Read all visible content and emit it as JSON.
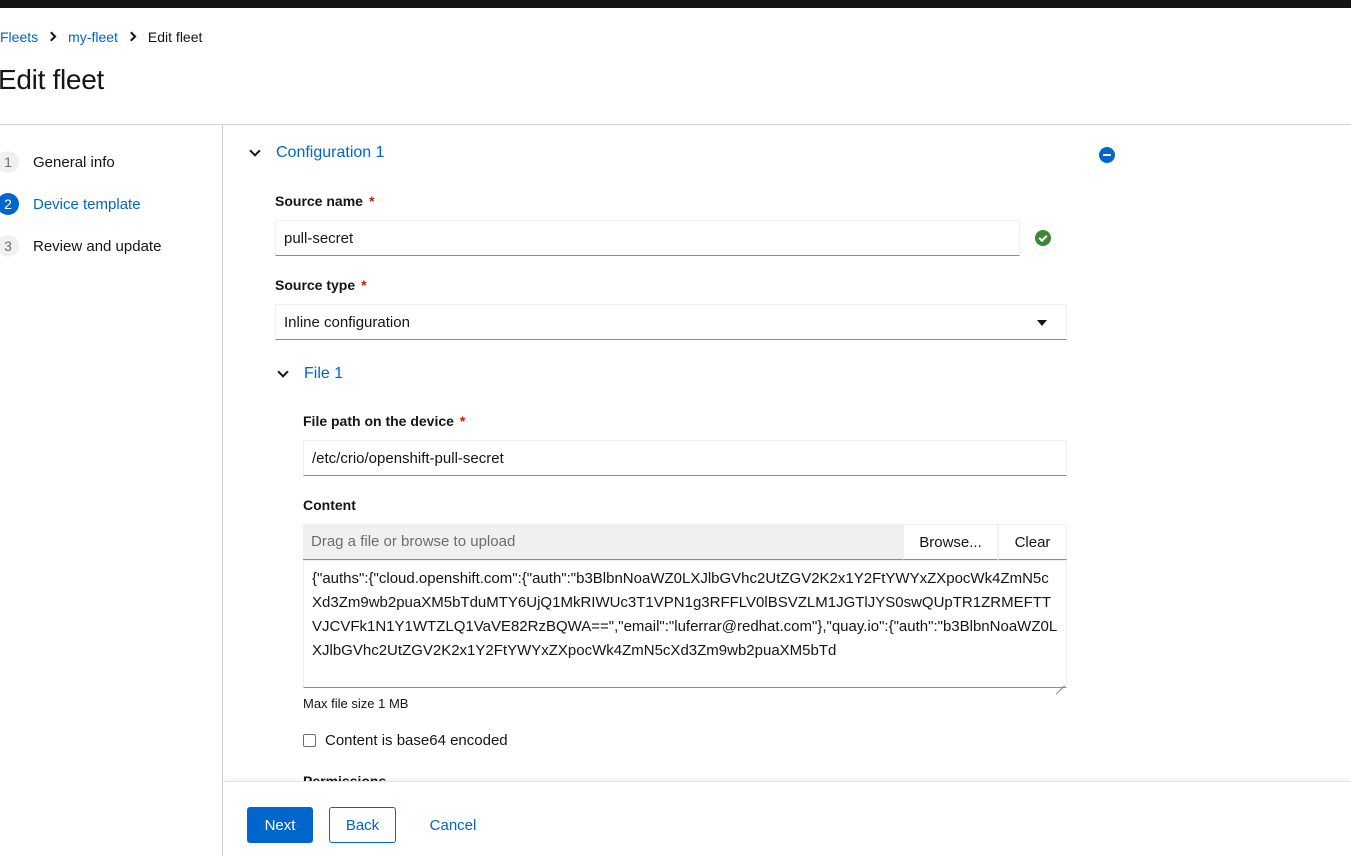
{
  "breadcrumb": {
    "items": [
      {
        "label": "Fleets"
      },
      {
        "label": "my-fleet"
      }
    ],
    "current": "Edit fleet"
  },
  "page": {
    "title": "Edit fleet"
  },
  "wizard": {
    "active_step": 2,
    "steps": [
      {
        "number": "1",
        "label": "General info"
      },
      {
        "number": "2",
        "label": "Device template"
      },
      {
        "number": "3",
        "label": "Review and update"
      }
    ]
  },
  "config": {
    "title": "Configuration 1",
    "source_name": {
      "label": "Source name",
      "required_mark": "*",
      "value": "pull-secret",
      "valid": true
    },
    "source_type": {
      "label": "Source type",
      "required_mark": "*",
      "selected": "Inline configuration"
    },
    "file": {
      "title": "File 1",
      "path": {
        "label": "File path on the device",
        "required_mark": "*",
        "value": "/etc/crio/openshift-pull-secret"
      },
      "content": {
        "label": "Content",
        "upload_placeholder": "Drag a file or browse to upload",
        "browse_label": "Browse...",
        "clear_label": "Clear",
        "value": "{\"auths\":{\"cloud.openshift.com\":{\"auth\":\"b3BlbnNoaWZ0LXJlbGVhc2UtZGV2K2x1Y2FtYWYxZXpocWk4ZmN5cXd3Zm9wb2puaXM5bTduMTY6UjQ1MkRIWUc3T1VPN1g3RFFLV0lBSVZLM1JGTlJYS0swQUpTR1ZRMEFTTVJCVFk1N1Y1WTZLQ1VaVE82RzBQWA==\",\"email\":\"luferrar@redhat.com\"},\"quay.io\":{\"auth\":\"b3BlbnNoaWZ0LXJlbGVhc2UtZGV2K2x1Y2FtYWYxZXpocWk4ZmN5cXd3Zm9wb2puaXM5bTd",
        "helper": "Max file size 1 MB"
      },
      "base64_checkbox": {
        "label": "Content is base64 encoded",
        "checked": false
      },
      "permissions_label": "Permissions"
    }
  },
  "footer": {
    "next_label": "Next",
    "back_label": "Back",
    "cancel_label": "Cancel"
  },
  "colors": {
    "primary": "#0066cc",
    "success": "#3e8635",
    "required": "#c9190b",
    "masthead": "#151515"
  }
}
